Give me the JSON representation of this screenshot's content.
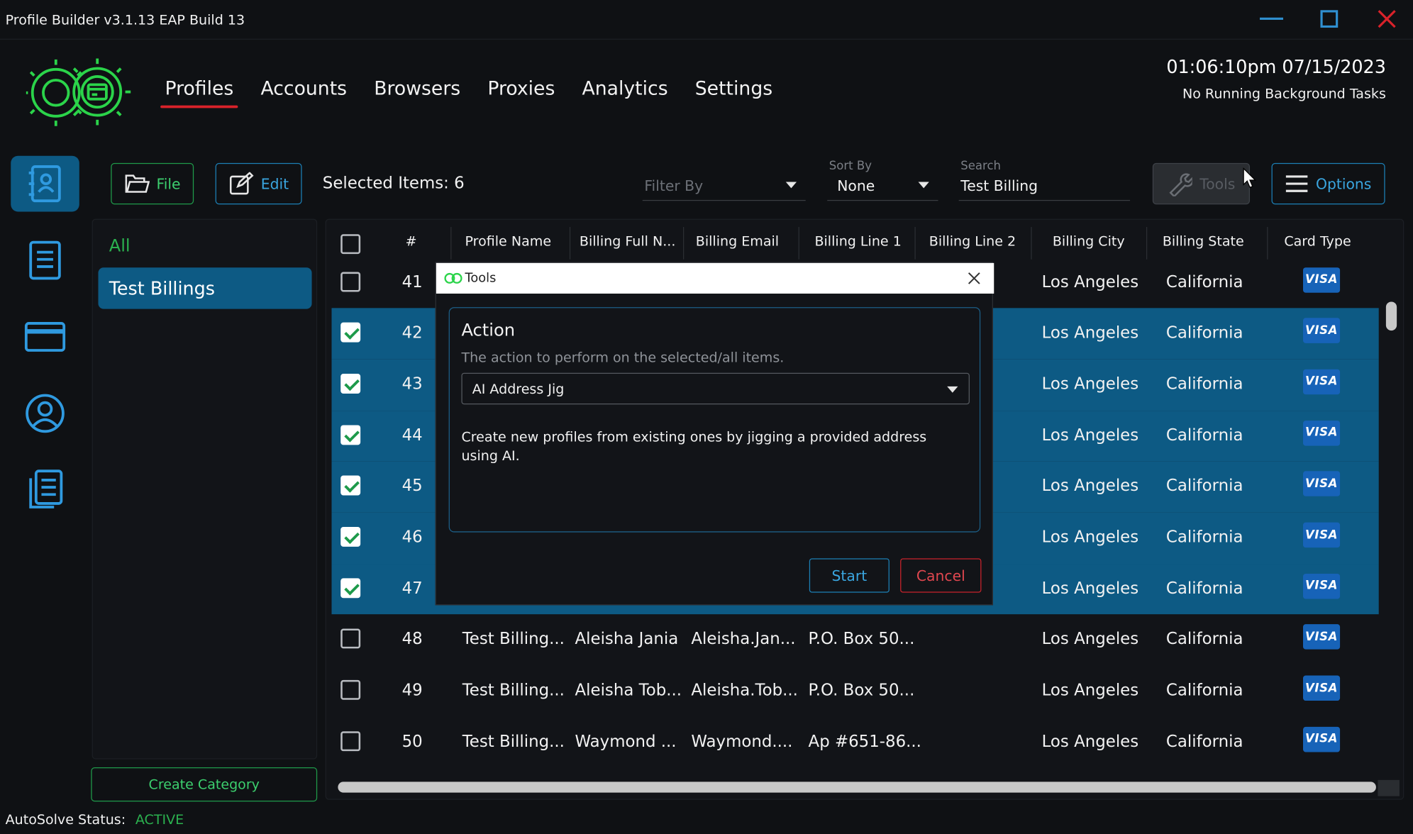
{
  "window": {
    "title": "Profile Builder v3.1.13 EAP Build 13",
    "controls": [
      "minimize-icon",
      "maximize-icon",
      "close-icon"
    ]
  },
  "nav": {
    "tabs": [
      {
        "label": "Profiles",
        "active": true
      },
      {
        "label": "Accounts"
      },
      {
        "label": "Browsers"
      },
      {
        "label": "Proxies"
      },
      {
        "label": "Analytics"
      },
      {
        "label": "Settings"
      }
    ]
  },
  "header": {
    "time": "01:06:10pm 07/15/2023",
    "tasks": "No Running Background Tasks"
  },
  "sidebar": {
    "icons": [
      "contacts-icon",
      "document-icon",
      "card-icon",
      "user-icon",
      "files-icon"
    ]
  },
  "toolbar": {
    "file_label": "File",
    "edit_label": "Edit",
    "selected_text": "Selected Items: 6",
    "filter_placeholder": "Filter By",
    "sort_label": "Sort By",
    "sort_value": "None",
    "search_label": "Search",
    "search_value": "Test Billing",
    "tools_label": "Tools",
    "options_label": "Options"
  },
  "categories": {
    "all_label": "All",
    "items": [
      "Test Billings"
    ],
    "create_label": "Create Category"
  },
  "table": {
    "columns": [
      "#",
      "Profile Name",
      "Billing Full N...",
      "Billing Email",
      "Billing Line 1",
      "Billing Line 2",
      "Billing City",
      "Billing State",
      "Card Type"
    ],
    "card_label": "VISA",
    "rows": [
      {
        "num": "41",
        "checked": false,
        "selected": false,
        "name": "",
        "full": "",
        "email": "",
        "line1": "",
        "city": "Los Angeles",
        "state": "California"
      },
      {
        "num": "42",
        "checked": true,
        "selected": true,
        "name": "",
        "full": "",
        "email": "",
        "line1": "",
        "city": "Los Angeles",
        "state": "California"
      },
      {
        "num": "43",
        "checked": true,
        "selected": true,
        "name": "",
        "full": "",
        "email": "",
        "line1": "",
        "city": "Los Angeles",
        "state": "California"
      },
      {
        "num": "44",
        "checked": true,
        "selected": true,
        "name": "",
        "full": "",
        "email": "",
        "line1": "",
        "city": "Los Angeles",
        "state": "California"
      },
      {
        "num": "45",
        "checked": true,
        "selected": true,
        "name": "",
        "full": "",
        "email": "",
        "line1": "",
        "city": "Los Angeles",
        "state": "California"
      },
      {
        "num": "46",
        "checked": true,
        "selected": true,
        "name": "",
        "full": "",
        "email": "",
        "line1": "",
        "city": "Los Angeles",
        "state": "California"
      },
      {
        "num": "47",
        "checked": true,
        "selected": true,
        "name": "",
        "full": "",
        "email": "",
        "line1": "",
        "city": "Los Angeles",
        "state": "California"
      },
      {
        "num": "48",
        "checked": false,
        "selected": false,
        "name": "Test Billing...",
        "full": "Aleisha Jania",
        "email": "Aleisha.Jan...",
        "line1": "P.O. Box 50...",
        "city": "Los Angeles",
        "state": "California"
      },
      {
        "num": "49",
        "checked": false,
        "selected": false,
        "name": "Test Billing...",
        "full": "Aleisha Tob...",
        "email": "Aleisha.Tob...",
        "line1": "P.O. Box 50...",
        "city": "Los Angeles",
        "state": "California"
      },
      {
        "num": "50",
        "checked": false,
        "selected": false,
        "name": "Test Billing...",
        "full": "Waymond ...",
        "email": "Waymond....",
        "line1": "Ap #651-86...",
        "city": "Los Angeles",
        "state": "California"
      }
    ]
  },
  "status": {
    "label": "AutoSolve Status:",
    "value": "ACTIVE"
  },
  "modal": {
    "title": "Tools",
    "action_title": "Action",
    "action_desc": "The action to perform on the selected/all items.",
    "selected_action": "AI Address Jig",
    "info": "Create new profiles from existing ones by jigging a provided address using AI.",
    "start_label": "Start",
    "cancel_label": "Cancel"
  },
  "colors": {
    "accent_blue": "#0d5a84",
    "green": "#2bb14f",
    "red": "#d9222a",
    "visa": "#1763b8"
  }
}
